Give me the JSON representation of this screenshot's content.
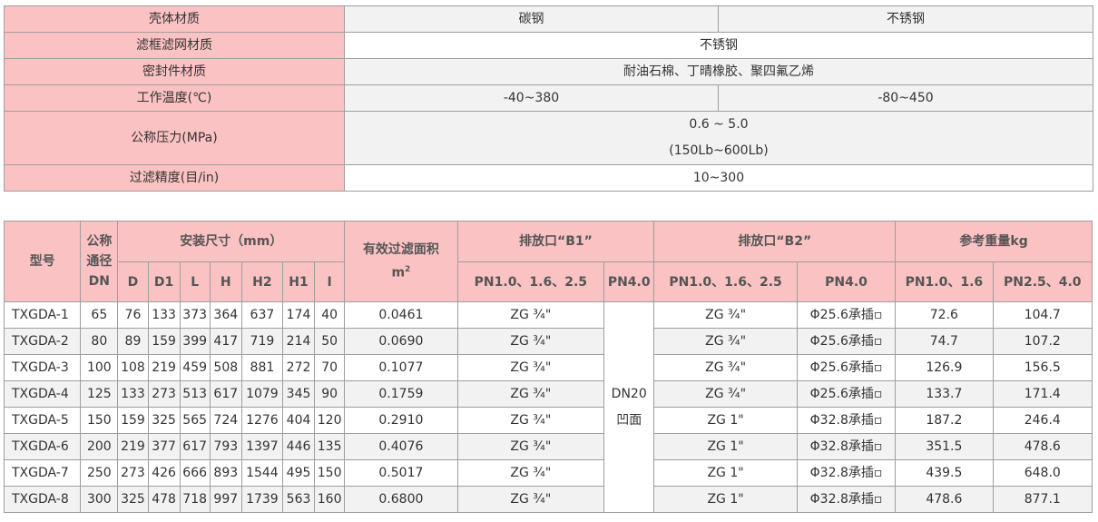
{
  "spec": {
    "shell_material": {
      "label": "壳体材质",
      "carbon": "碳钢",
      "stainless": "不锈钢"
    },
    "screen_material": {
      "label": "滤框滤网材质",
      "value": "不锈钢"
    },
    "seal_material": {
      "label": "密封件材质",
      "value": "耐油石棉、丁晴橡胶、聚四氟乙烯"
    },
    "temperature": {
      "label": "工作温度(℃)",
      "carbon": "-40~380",
      "stainless": "-80~450"
    },
    "pressure": {
      "label": "公称压力(MPa)",
      "line1": "0.6 ~ 5.0",
      "line2": "(150Lb~600Lb)"
    },
    "precision": {
      "label": "过滤精度(目/in)",
      "value": "10~300"
    }
  },
  "dims": {
    "headers": {
      "model": "型号",
      "dn_line1": "公称",
      "dn_line2": "通径",
      "dn_line3": "DN",
      "install": "安装尺寸（mm）",
      "area_line1": "有效过滤面积",
      "area_unit": "m",
      "area_exp": "2",
      "b1": "排放口“B1”",
      "b2": "排放口“B2”",
      "weight": "参考重量kg",
      "cols": [
        "D",
        "D1",
        "L",
        "H",
        "H2",
        "H1",
        "I"
      ],
      "b1_low": "PN1.0、1.6、2.5",
      "b1_high": "PN4.0",
      "b2_low": "PN1.0、1.6、2.5",
      "b2_high": "PN4.0",
      "w_low": "PN1.0、1.6",
      "w_high": "PN2.5、4.0"
    },
    "b1_high_merged_line1": "DN20",
    "b1_high_merged_line2": "凹面",
    "rows": [
      {
        "model": "TXGDA-1",
        "dn": "65",
        "D": "76",
        "D1": "133",
        "L": "373",
        "H": "364",
        "H2": "637",
        "H1": "174",
        "I": "40",
        "area": "0.0461",
        "b1": "ZG ¾\"",
        "b2": "ZG ¾\"",
        "b2h": "Φ25.6承插▫",
        "w1": "72.6",
        "w2": "104.7"
      },
      {
        "model": "TXGDA-2",
        "dn": "80",
        "D": "89",
        "D1": "159",
        "L": "399",
        "H": "417",
        "H2": "719",
        "H1": "214",
        "I": "50",
        "area": "0.0690",
        "b1": "ZG ¾\"",
        "b2": "ZG ¾\"",
        "b2h": "Φ25.6承插▫",
        "w1": "74.7",
        "w2": "107.2"
      },
      {
        "model": "TXGDA-3",
        "dn": "100",
        "D": "108",
        "D1": "219",
        "L": "459",
        "H": "508",
        "H2": "881",
        "H1": "272",
        "I": "70",
        "area": "0.1077",
        "b1": "ZG ¾\"",
        "b2": "ZG ¾\"",
        "b2h": "Φ25.6承插▫",
        "w1": "126.9",
        "w2": "156.5"
      },
      {
        "model": "TXGDA-4",
        "dn": "125",
        "D": "133",
        "D1": "273",
        "L": "513",
        "H": "617",
        "H2": "1079",
        "H1": "345",
        "I": "90",
        "area": "0.1759",
        "b1": "ZG ¾\"",
        "b2": "ZG ¾\"",
        "b2h": "Φ25.6承插▫",
        "w1": "133.7",
        "w2": "171.4"
      },
      {
        "model": "TXGDA-5",
        "dn": "150",
        "D": "159",
        "D1": "325",
        "L": "565",
        "H": "724",
        "H2": "1276",
        "H1": "404",
        "I": "120",
        "area": "0.2910",
        "b1": "ZG ¾\"",
        "b2": "ZG 1\"",
        "b2h": "Φ32.8承插▫",
        "w1": "187.2",
        "w2": "246.4"
      },
      {
        "model": "TXGDA-6",
        "dn": "200",
        "D": "219",
        "D1": "377",
        "L": "617",
        "H": "793",
        "H2": "1397",
        "H1": "446",
        "I": "135",
        "area": "0.4076",
        "b1": "ZG ¾\"",
        "b2": "ZG 1\"",
        "b2h": "Φ32.8承插▫",
        "w1": "351.5",
        "w2": "478.6"
      },
      {
        "model": "TXGDA-7",
        "dn": "250",
        "D": "273",
        "D1": "426",
        "L": "666",
        "H": "893",
        "H2": "1544",
        "H1": "495",
        "I": "150",
        "area": "0.5017",
        "b1": "ZG ¾\"",
        "b2": "ZG 1\"",
        "b2h": "Φ32.8承插▫",
        "w1": "439.5",
        "w2": "648.0"
      },
      {
        "model": "TXGDA-8",
        "dn": "300",
        "D": "325",
        "D1": "478",
        "L": "718",
        "H": "997",
        "H2": "1739",
        "H1": "563",
        "I": "160",
        "area": "0.6800",
        "b1": "ZG ¾\"",
        "b2": "ZG 1\"",
        "b2h": "Φ32.8承插▫",
        "w1": "478.6",
        "w2": "877.1"
      }
    ]
  }
}
